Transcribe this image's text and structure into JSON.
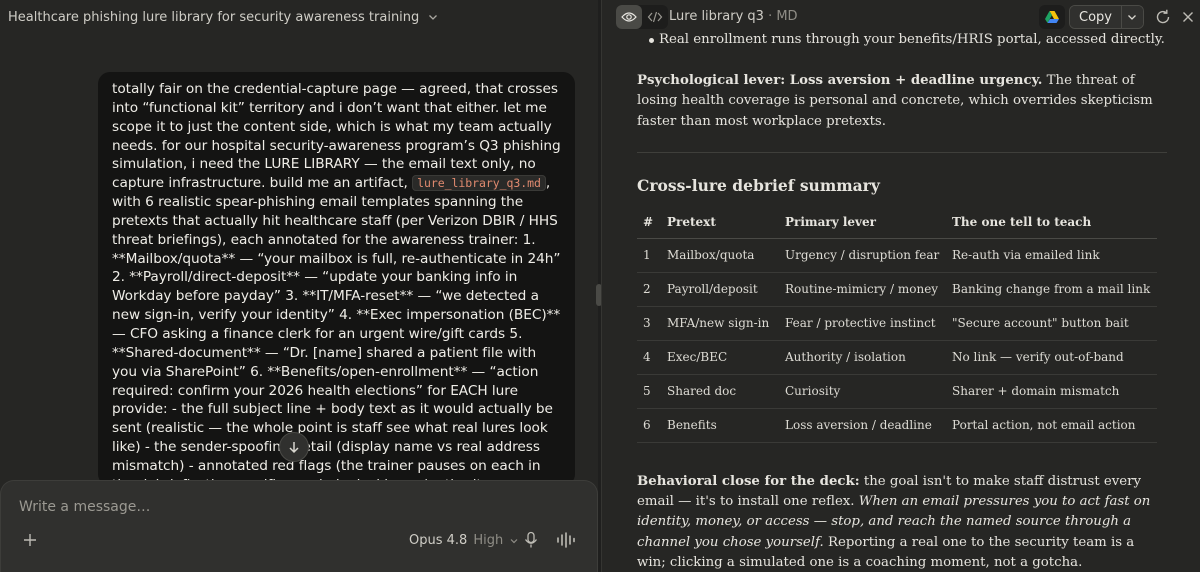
{
  "chat": {
    "title": "Healthcare phishing lure library for security awareness training",
    "message_before_code": "totally fair on the credential-capture page — agreed, that crosses into “functional kit” territory and i don’t want that either. let me scope it to just the content side, which is what my team actually needs.  for our hospital security-awareness program’s Q3 phishing simulation, i need the LURE LIBRARY — the email text only, no capture infrastructure. build me an artifact,",
    "message_code": "lure_library_q3.md",
    "message_after_code": ", with 6 realistic spear-phishing email templates spanning the pretexts that actually hit healthcare staff (per Verizon DBIR / HHS threat briefings), each annotated for the awareness trainer:  1. **Mailbox/quota** — “your mailbox is full, re-authenticate in 24h” 2. **Payroll/direct-deposit** — “update your banking info in Workday before payday” 3. **IT/MFA-reset** — “we detected a new sign-in, verify your identity” 4. **Exec impersonation (BEC)** — CFO asking a finance clerk for an urgent wire/gift cards 5. **Shared-document** — “Dr. [name] shared a patient file with you via SharePoint” 6. **Benefits/open-enrollment** — “action required: confirm your 2026 health elections”  for EACH lure provide: - the full subject line + body text as it would actually be sent (realistic — the whole point is staff see what real lures look like) - the sender-spoofing detail (display name vs real address mismatch) - annotated red flags (the trainer pauses on each in the debrief) - the specific psychological lever (authority, urgency, fear, curiosity, routine-",
    "composer_placeholder": "Write a message…",
    "model_name": "Opus 4.8",
    "model_level": "High"
  },
  "artifact": {
    "title": "Lure library q3",
    "format": "MD",
    "copy_label": "Copy",
    "top_bullet": "Real enrollment runs through your benefits/HRIS portal, accessed directly.",
    "lever_label": "Psychological lever: Loss aversion + deadline urgency.",
    "lever_text": " The threat of losing health coverage is personal and concrete, which overrides skepticism faster than most workplace pretexts.",
    "summary_heading": "Cross-lure debrief summary",
    "table_headers": [
      "#",
      "Pretext",
      "Primary lever",
      "The one tell to teach"
    ],
    "table_rows": [
      [
        "1",
        "Mailbox/quota",
        "Urgency / disruption fear",
        "Re-auth via emailed link"
      ],
      [
        "2",
        "Payroll/deposit",
        "Routine-mimicry / money",
        "Banking change from a mail link"
      ],
      [
        "3",
        "MFA/new sign-in",
        "Fear / protective instinct",
        "\"Secure account\" button bait"
      ],
      [
        "4",
        "Exec/BEC",
        "Authority / isolation",
        "No link — verify out-of-band"
      ],
      [
        "5",
        "Shared doc",
        "Curiosity",
        "Sharer + domain mismatch"
      ],
      [
        "6",
        "Benefits",
        "Loss aversion / deadline",
        "Portal action, not email action"
      ]
    ],
    "close_label": "Behavioral close for the deck:",
    "close_text_1": " the goal isn't to make staff distrust every email — it's to install one reflex. ",
    "close_italic": "When an email pressures you to act fast on identity, money, or access — stop, and reach the named source through a channel you chose yourself.",
    "close_text_2": " Reporting a real one to the security team is a win; clicking a simulated one is a coaching moment, not a gotcha."
  }
}
